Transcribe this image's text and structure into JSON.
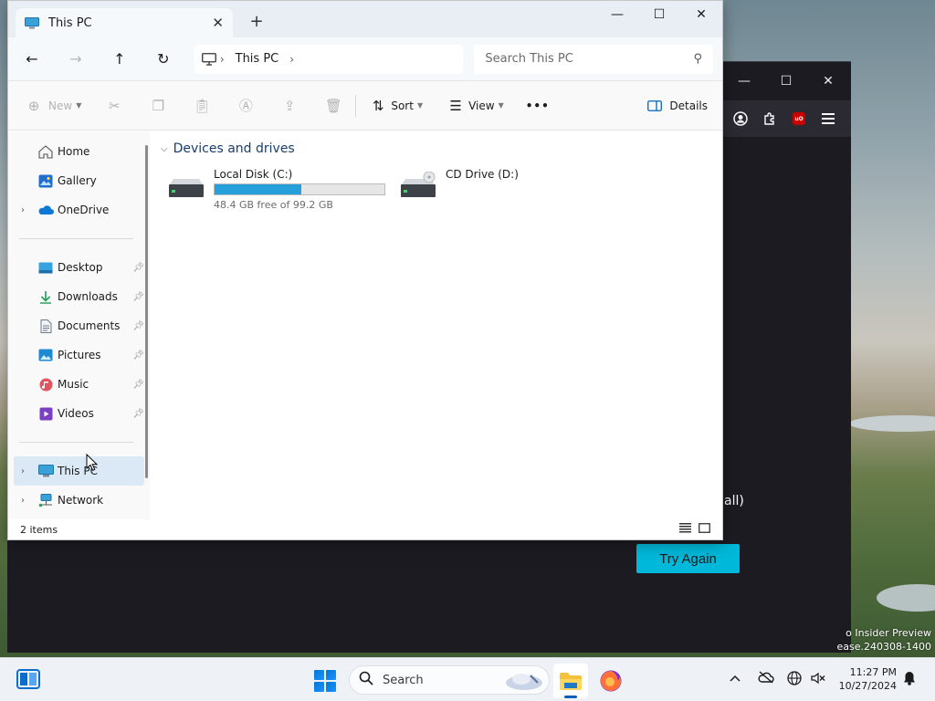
{
  "explorer": {
    "tab_title": "This PC",
    "new_tab": "+",
    "window_controls": {
      "minimize": "—",
      "maximize": "☐",
      "close": "✕"
    },
    "nav": {
      "back": "←",
      "forward": "→",
      "up": "↑",
      "refresh": "↻"
    },
    "address": {
      "crumb": "This PC"
    },
    "search": {
      "placeholder": "Search This PC"
    },
    "toolbar": {
      "new_label": "New",
      "sort_label": "Sort",
      "view_label": "View",
      "more_label": "•••",
      "details_label": "Details"
    },
    "sidebar": {
      "items": [
        {
          "label": "Home",
          "icon": "home-icon"
        },
        {
          "label": "Gallery",
          "icon": "gallery-icon"
        },
        {
          "label": "OneDrive",
          "icon": "cloud-icon"
        },
        {
          "label": "Desktop",
          "icon": "desktop-icon"
        },
        {
          "label": "Downloads",
          "icon": "download-icon"
        },
        {
          "label": "Documents",
          "icon": "document-icon"
        },
        {
          "label": "Pictures",
          "icon": "pictures-icon"
        },
        {
          "label": "Music",
          "icon": "music-icon"
        },
        {
          "label": "Videos",
          "icon": "videos-icon"
        },
        {
          "label": "This PC",
          "icon": "pc-icon"
        },
        {
          "label": "Network",
          "icon": "network-icon"
        }
      ]
    },
    "group_header": "Devices and drives",
    "drives": [
      {
        "name": "Local Disk (C:)",
        "free_text": "48.4 GB free of 99.2 GB",
        "used_fraction": 0.512
      },
      {
        "name": "CD Drive (D:)"
      }
    ],
    "status": {
      "item_count": "2 items"
    }
  },
  "background_app": {
    "partial_text": "all)",
    "try_again": "Try Again",
    "controls": {
      "minimize": "—",
      "maximize": "☐",
      "close": "✕"
    }
  },
  "watermark": {
    "line1": "o Insider Preview",
    "line2": "ease.240308-1400"
  },
  "taskbar": {
    "search_label": "Search",
    "time": "11:27 PM",
    "date": "10/27/2024"
  },
  "colors": {
    "accent": "#0078d4",
    "drive_fill": "#26a0da",
    "try_again": "#00b8d9"
  }
}
